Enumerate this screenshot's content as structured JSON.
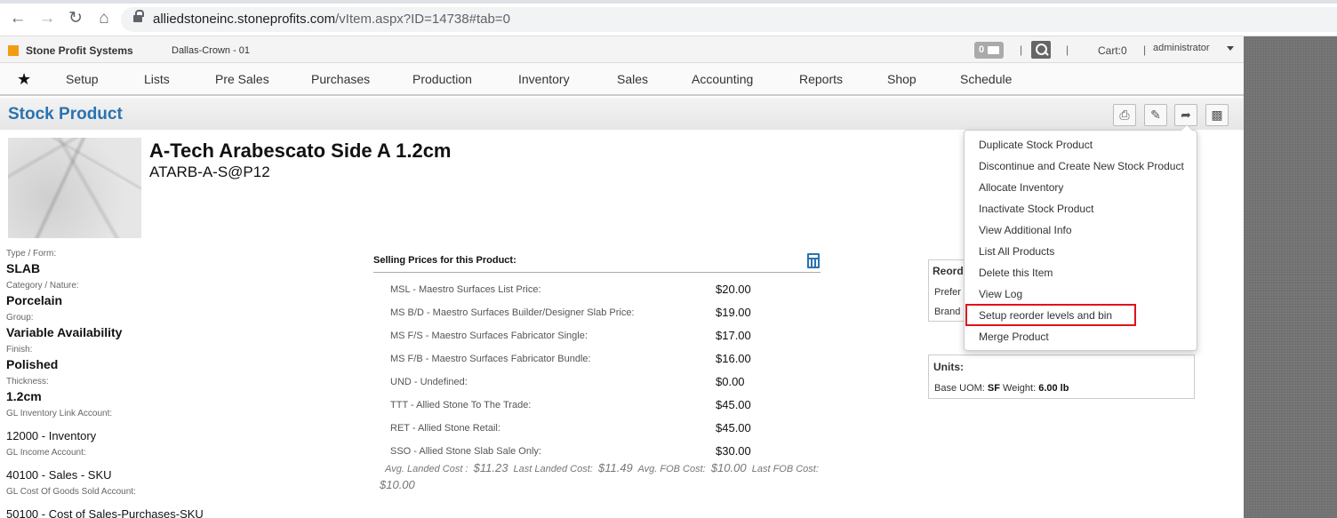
{
  "browser": {
    "url_host": "alliedstoneinc.stoneprofits.com",
    "url_path": "/vItem.aspx?ID=14738#tab=0"
  },
  "header": {
    "brand": "Stone Profit Systems",
    "location": "Dallas-Crown - 01",
    "mail_count": "0",
    "cart": "Cart:0",
    "user": "administrator"
  },
  "menu": [
    "Setup",
    "Lists",
    "Pre Sales",
    "Purchases",
    "Production",
    "Inventory",
    "Sales",
    "Accounting",
    "Reports",
    "Shop",
    "Schedule"
  ],
  "page": {
    "title": "Stock Product"
  },
  "product": {
    "name": "A-Tech Arabescato Side A 1.2cm",
    "code": "ATARB-A-S@P12",
    "attributes": [
      {
        "label": "Type / Form:",
        "value": "SLAB"
      },
      {
        "label": "Category / Nature:",
        "value": "Porcelain"
      },
      {
        "label": "Group:",
        "value": "Variable Availability"
      },
      {
        "label": "Finish:",
        "value": "Polished"
      },
      {
        "label": "Thickness:",
        "value": "1.2cm"
      }
    ],
    "accounts": [
      {
        "label": "GL Inventory Link Account:",
        "value": "12000 - Inventory"
      },
      {
        "label": "GL Income Account:",
        "value": "40100 - Sales - SKU"
      },
      {
        "label": "GL Cost Of Goods Sold Account:",
        "value": "50100 - Cost of Sales-Purchases-SKU"
      }
    ]
  },
  "prices": {
    "heading": "Selling Prices for this Product:",
    "rows": [
      {
        "label": "MSL - Maestro Surfaces List Price:",
        "value": "$20.00"
      },
      {
        "label": "MS B/D - Maestro Surfaces Builder/Designer Slab Price:",
        "value": "$19.00"
      },
      {
        "label": "MS F/S - Maestro Surfaces Fabricator Single:",
        "value": "$17.00"
      },
      {
        "label": "MS F/B - Maestro Surfaces Fabricator Bundle:",
        "value": "$16.00"
      },
      {
        "label": "UND - Undefined:",
        "value": "$0.00"
      },
      {
        "label": "TTT - Allied Stone To The Trade:",
        "value": "$45.00"
      },
      {
        "label": "RET - Allied Stone Retail:",
        "value": "$45.00"
      },
      {
        "label": "SSO - Allied Stone Slab Sale Only:",
        "value": "$30.00"
      }
    ],
    "costs": {
      "avg_landed_label": "Avg. Landed Cost :",
      "avg_landed": "$11.23",
      "last_landed_label": "Last Landed Cost:",
      "last_landed": "$11.49",
      "avg_fob_label": "Avg. FOB Cost:",
      "avg_fob": "$10.00",
      "last_fob_label": "Last FOB Cost:",
      "last_fob": "$10.00"
    }
  },
  "reorder": {
    "heading": "Reord",
    "row1": "Prefer",
    "row2": "Brand"
  },
  "units": {
    "heading": "Units:",
    "base_uom_label": "Base UOM:",
    "base_uom": "SF",
    "weight_label": "Weight:",
    "weight": "6.00 lb"
  },
  "dropdown": {
    "items": [
      "Duplicate Stock Product",
      "Discontinue and Create New Stock Product",
      "Allocate Inventory",
      "Inactivate Stock Product",
      "View Additional Info",
      "List All Products",
      "Delete this Item",
      "View Log",
      "Setup reorder levels and bin",
      "Merge Product"
    ]
  },
  "colors": {
    "accent": "#2a73b0",
    "highlight": "#e0121b",
    "logo": "#f39c12"
  }
}
